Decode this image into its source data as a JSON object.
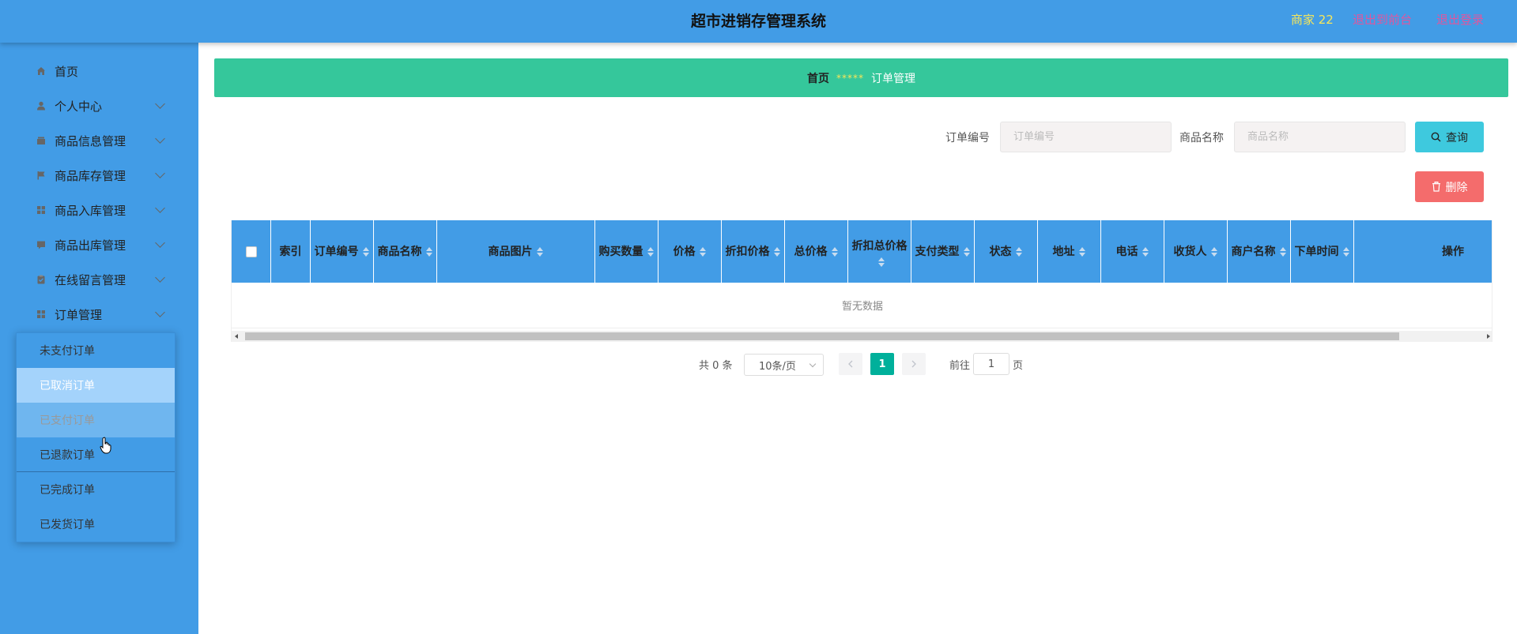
{
  "header": {
    "title": "超市进销存管理系统",
    "user": "商家 22",
    "front_link": "退出到前台",
    "logout_link": "退出登录",
    "bg_color": "#429ce6"
  },
  "sidebar": {
    "items": [
      {
        "label": "首页",
        "icon": "home-icon"
      },
      {
        "label": "个人中心",
        "icon": "user-icon"
      },
      {
        "label": "商品信息管理",
        "icon": "box-icon"
      },
      {
        "label": "商品库存管理",
        "icon": "flag-icon"
      },
      {
        "label": "商品入库管理",
        "icon": "grid-icon"
      },
      {
        "label": "商品出库管理",
        "icon": "chat-icon"
      },
      {
        "label": "在线留言管理",
        "icon": "clipboard-icon"
      },
      {
        "label": "订单管理",
        "icon": "grid-icon"
      }
    ],
    "submenu": [
      {
        "label": "未支付订单"
      },
      {
        "label": "已取消订单"
      },
      {
        "label": "已支付订单"
      },
      {
        "label": "已退款订单"
      },
      {
        "label": "已完成订单"
      },
      {
        "label": "已发货订单"
      }
    ]
  },
  "breadcrumb": {
    "home": "首页",
    "separator": "*****",
    "current": "订单管理"
  },
  "search": {
    "order_no_label": "订单编号",
    "order_no_placeholder": "订单编号",
    "product_name_label": "商品名称",
    "product_name_placeholder": "商品名称",
    "query_button": "查询",
    "delete_button": "删除"
  },
  "table": {
    "columns": [
      "索引",
      "订单编号",
      "商品名称",
      "商品图片",
      "购买数量",
      "价格",
      "折扣价格",
      "总价格",
      "折扣总价格",
      "支付类型",
      "状态",
      "地址",
      "电话",
      "收货人",
      "商户名称",
      "下单时间",
      "操作"
    ],
    "empty_text": "暂无数据"
  },
  "pagination": {
    "total": "共 0 条",
    "page_size": "10条/页",
    "current_page": "1",
    "goto_label": "前往",
    "goto_value": "1",
    "page_label": "页"
  }
}
